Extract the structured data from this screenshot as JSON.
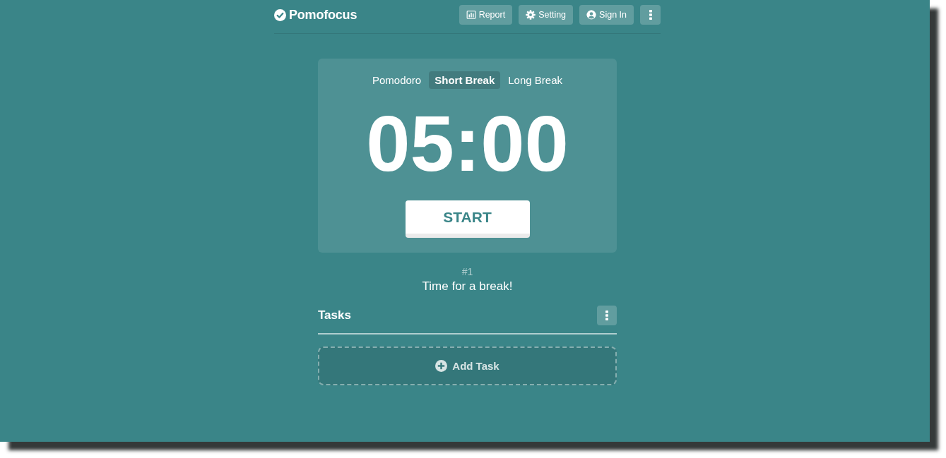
{
  "header": {
    "logo": "Pomofocus",
    "buttons": [
      {
        "kind": "report",
        "label": "Report"
      },
      {
        "kind": "setting",
        "label": "Setting"
      },
      {
        "kind": "account",
        "label": "Sign In"
      },
      {
        "kind": "menu"
      }
    ]
  },
  "timer": {
    "tabs": [
      {
        "label": "Pomodoro",
        "selected": false
      },
      {
        "label": "Short Break",
        "selected": true
      },
      {
        "label": "Long Break",
        "selected": false
      }
    ],
    "time": "05:00",
    "start_button": "START"
  },
  "session": {
    "count": "#1",
    "message": "Time for a break!"
  },
  "tasks": {
    "title": "Tasks",
    "add_task": "Add Task"
  }
}
